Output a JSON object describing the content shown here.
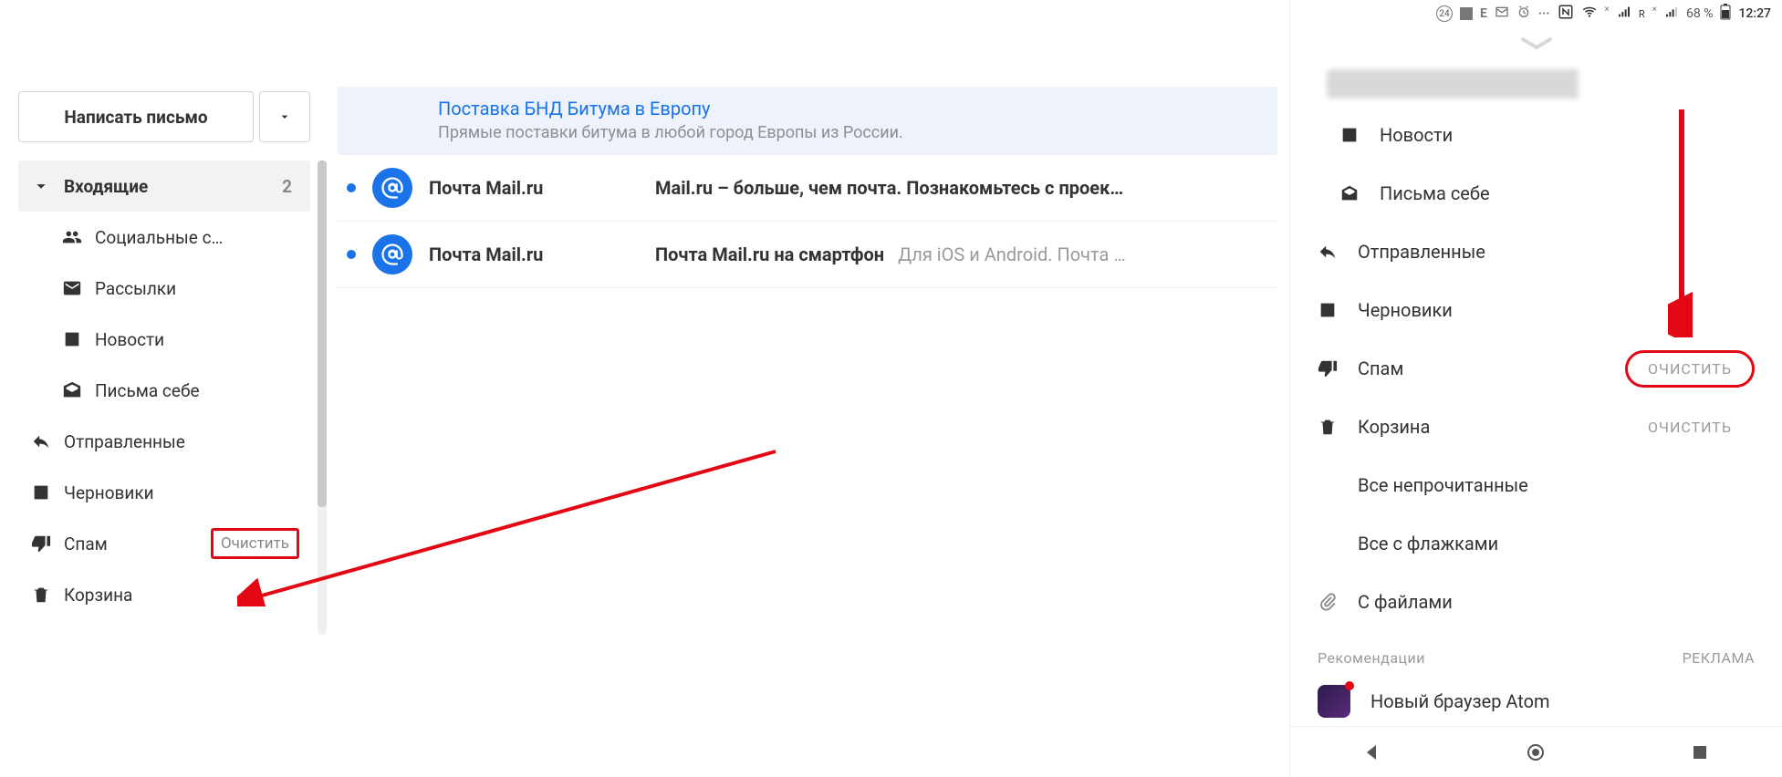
{
  "compose": {
    "label": "Написать письмо"
  },
  "sidebar": {
    "items": [
      {
        "label": "Входящие",
        "count": "2",
        "active": true
      },
      {
        "label": "Социальные с…"
      },
      {
        "label": "Рассылки"
      },
      {
        "label": "Новости"
      },
      {
        "label": "Письма себе"
      },
      {
        "label": "Отправленные"
      },
      {
        "label": "Черновики"
      },
      {
        "label": "Спам",
        "clear": "Очистить"
      },
      {
        "label": "Корзина"
      }
    ]
  },
  "promo": {
    "title": "Поставка БНД Битума в Европу",
    "subtitle": "Прямые поставки битума в любой город Европы из России."
  },
  "messages": [
    {
      "sender": "Почта Mail.ru",
      "subject": "Mail.ru – больше, чем почта. Познакомьтесь с проек…",
      "preview": ""
    },
    {
      "sender": "Почта Mail.ru",
      "subject": "Почта Mail.ru на смартфон",
      "preview": "Для iOS и Android. Почта …"
    }
  ],
  "mobile": {
    "status": {
      "battery": "68 %",
      "time": "12:27",
      "notif_count": "24",
      "net": "R"
    },
    "items": [
      {
        "label": "Новости",
        "nested": true,
        "icon": "news"
      },
      {
        "label": "Письма себе",
        "nested": true,
        "icon": "inbox-self"
      },
      {
        "label": "Отправленные",
        "nested": false,
        "icon": "sent"
      },
      {
        "label": "Черновики",
        "nested": false,
        "icon": "drafts"
      },
      {
        "label": "Спам",
        "nested": false,
        "icon": "spam",
        "clear": "ОЧИСТИТЬ",
        "hl": true
      },
      {
        "label": "Корзина",
        "nested": false,
        "icon": "trash",
        "clear": "ОЧИСТИТЬ"
      },
      {
        "label": "Все непрочитанные",
        "nested": false,
        "icon": "dot-blue"
      },
      {
        "label": "Все с флажками",
        "nested": false,
        "icon": "bookmark"
      },
      {
        "label": "С файлами",
        "nested": false,
        "icon": "attach"
      }
    ],
    "section": {
      "left": "Рекомендации",
      "right": "РЕКЛАМА"
    },
    "reco": {
      "label": "Новый браузер Atom"
    }
  }
}
